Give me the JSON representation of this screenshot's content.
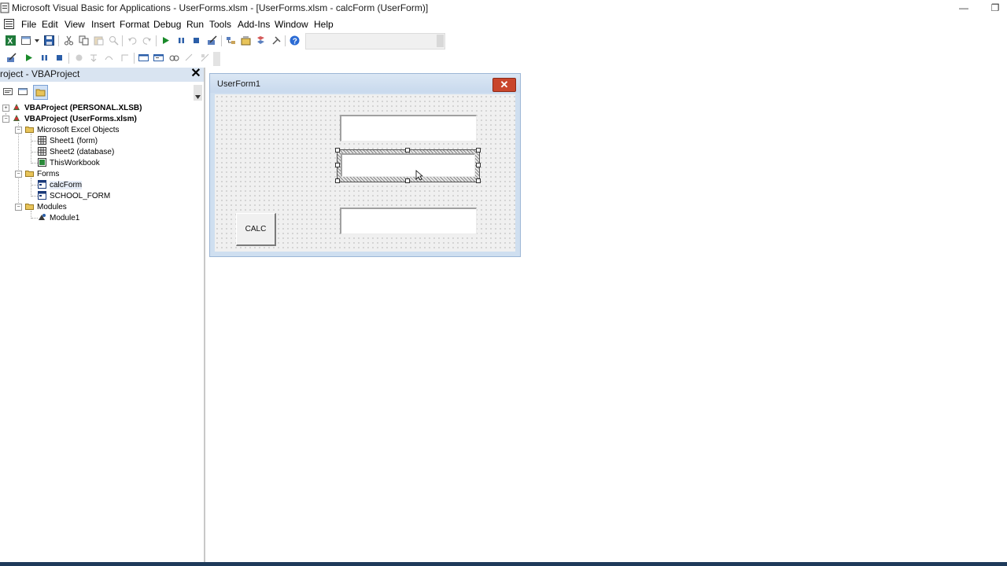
{
  "window": {
    "title": "Microsoft Visual Basic for Applications - UserForms.xlsm - [UserForms.xlsm - calcForm (UserForm)]",
    "minimize_glyph": "—",
    "restore_glyph": "❐"
  },
  "menu": {
    "items": [
      "File",
      "Edit",
      "View",
      "Insert",
      "Format",
      "Debug",
      "Run",
      "Tools",
      "Add-Ins",
      "Window",
      "Help"
    ]
  },
  "project_panel": {
    "title": "roject - VBAProject",
    "close_glyph": "✕",
    "tree": {
      "personal": "VBAProject (PERSONAL.XLSB)",
      "userforms": "VBAProject (UserForms.xlsm)",
      "excel_objects": "Microsoft Excel Objects",
      "sheet1": "Sheet1 (form)",
      "sheet2": "Sheet2 (database)",
      "thisworkbook": "ThisWorkbook",
      "forms": "Forms",
      "calcform": "calcForm",
      "school_form": "SCHOOL_FORM",
      "modules": "Modules",
      "module1": "Module1"
    },
    "expanders": {
      "plus": "+",
      "minus": "−"
    }
  },
  "userform": {
    "title": "UserForm1",
    "close_glyph": "✕",
    "calc_button": "CALC"
  },
  "colors": {
    "menu_accent": "#d9e4f1",
    "form_close": "#c9462c",
    "folder": "#e8c45a"
  },
  "icons": [
    "app-icon",
    "excel-icon",
    "save-icon",
    "run-icon",
    "break-icon",
    "reset-icon",
    "help-icon",
    "folder-icon",
    "module-icon",
    "form-icon",
    "sheet-icon",
    "project-icon"
  ]
}
